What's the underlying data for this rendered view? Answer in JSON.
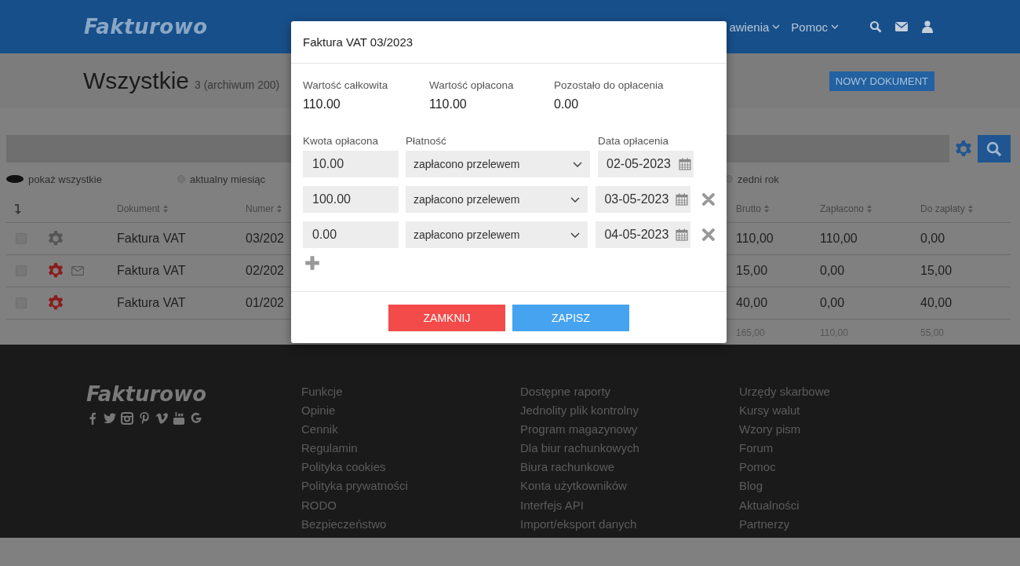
{
  "header": {
    "logo": "Fakturowo",
    "nav": [
      {
        "label": "awienia",
        "dropdown": true
      },
      {
        "label": "Pomoc",
        "dropdown": true
      }
    ]
  },
  "page_title": {
    "title": "Wszystkie",
    "count": "3 (archiwum 200)"
  },
  "new_document_button": "NOWY DOKUMENT",
  "filters": [
    {
      "label": "pokaż wszystkie",
      "selected": true
    },
    {
      "label": "aktualny miesiąc",
      "selected": false
    },
    {
      "label": "zedni rok",
      "selected": false
    }
  ],
  "table": {
    "columns": [
      {
        "label": "Dokument",
        "sortable": true
      },
      {
        "label": "Numer",
        "sortable": true
      },
      {
        "label": "Brutto",
        "sortable": true
      },
      {
        "label": "Zapłacono",
        "sortable": true
      },
      {
        "label": "Do zapłaty",
        "sortable": true
      }
    ],
    "rows": [
      {
        "checked": false,
        "color": "#555555",
        "mail": false,
        "document": "Faktura VAT",
        "number": "03/202",
        "gross": "110,00",
        "paid": "110,00",
        "due": "0,00"
      },
      {
        "checked": false,
        "color": "#8c1c1c",
        "mail": true,
        "document": "Faktura VAT",
        "number": "02/202",
        "gross": "15,00",
        "paid": "0,00",
        "due": "15,00"
      },
      {
        "checked": false,
        "color": "#8c1c1c",
        "mail": false,
        "document": "Faktura VAT",
        "number": "01/202",
        "gross": "40,00",
        "paid": "0,00",
        "due": "40,00"
      }
    ],
    "totals": {
      "gross": "165,00",
      "paid": "110,00",
      "due": "55,00"
    }
  },
  "modal": {
    "title": "Faktura VAT 03/2023",
    "summary": [
      {
        "label": "Wartość całkowita",
        "value": "110.00"
      },
      {
        "label": "Wartość opłacona",
        "value": "110.00"
      },
      {
        "label": "Pozostało do opłacenia",
        "value": "0.00"
      }
    ],
    "payment_labels": {
      "amount": "Kwota opłacona",
      "method": "Płatność",
      "date": "Data opłacenia"
    },
    "payments": [
      {
        "amount": "10.00",
        "method": "zapłacono przelewem",
        "date": "02-05-2023",
        "removable": false
      },
      {
        "amount": "100.00",
        "method": "zapłacono przelewem",
        "date": "03-05-2023",
        "removable": true
      },
      {
        "amount": "0.00",
        "method": "zapłacono przelewem",
        "date": "04-05-2023",
        "removable": true
      }
    ],
    "buttons": [
      {
        "label": "ZAMKNIJ",
        "kind": "danger"
      },
      {
        "label": "ZAPISZ",
        "kind": "primary"
      }
    ]
  },
  "footer": {
    "logo": "Fakturowo",
    "columns": [
      [
        "Funkcje",
        "Opinie",
        "Cennik",
        "Regulamin",
        "Polityka cookies",
        "Polityka prywatności",
        "RODO",
        "Bezpieczeństwo"
      ],
      [
        "Dostępne raporty",
        "Jednolity plik kontrolny",
        "Program magazynowy",
        "Dla biur rachunkowych",
        "Biura rachunkowe",
        "Konta użytkowników",
        "Interfejs API",
        "Import/eksport danych"
      ],
      [
        "Urzędy skarbowe",
        "Kursy walut",
        "Wzory pism",
        "Forum",
        "Pomoc",
        "Blog",
        "Aktualności",
        "Partnerzy"
      ]
    ]
  }
}
